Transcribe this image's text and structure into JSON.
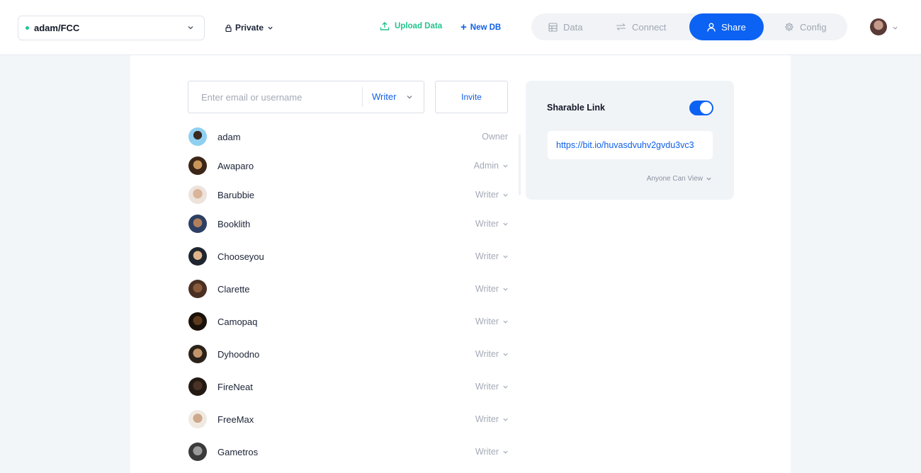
{
  "header": {
    "db_name": "adam/FCC",
    "visibility": "Private",
    "upload_label": "Upload Data",
    "new_db_label": "New DB",
    "tabs": [
      {
        "label": "Data",
        "icon": "table-icon",
        "active": false
      },
      {
        "label": "Connect",
        "icon": "arrows-exchange-icon",
        "active": false
      },
      {
        "label": "Share",
        "icon": "user-icon",
        "active": true
      },
      {
        "label": "Config",
        "icon": "gear-icon",
        "active": false
      }
    ]
  },
  "invite": {
    "placeholder": "Enter email or username",
    "role": "Writer",
    "button_label": "Invite"
  },
  "members": [
    {
      "name": "adam",
      "role": "Owner"
    },
    {
      "name": "Awaparo",
      "role": "Admin"
    },
    {
      "name": "Barubbie",
      "role": "Writer"
    },
    {
      "name": "Booklith",
      "role": "Writer"
    },
    {
      "name": "Chooseyou",
      "role": "Writer"
    },
    {
      "name": "Clarette",
      "role": "Writer"
    },
    {
      "name": "Camopaq",
      "role": "Writer"
    },
    {
      "name": "Dyhoodno",
      "role": "Writer"
    },
    {
      "name": "FireNeat",
      "role": "Writer"
    },
    {
      "name": "FreeMax",
      "role": "Writer"
    },
    {
      "name": "Gametros",
      "role": "Writer"
    }
  ],
  "share": {
    "title": "Sharable Link",
    "enabled": true,
    "link": "https://bit.io/huvasdvuhv2gvdu3vc3",
    "permission": "Anyone Can View"
  },
  "colors": {
    "accent": "#0b62f3",
    "link": "#1160e8",
    "success": "#22c38e",
    "muted": "#a3aab6"
  }
}
